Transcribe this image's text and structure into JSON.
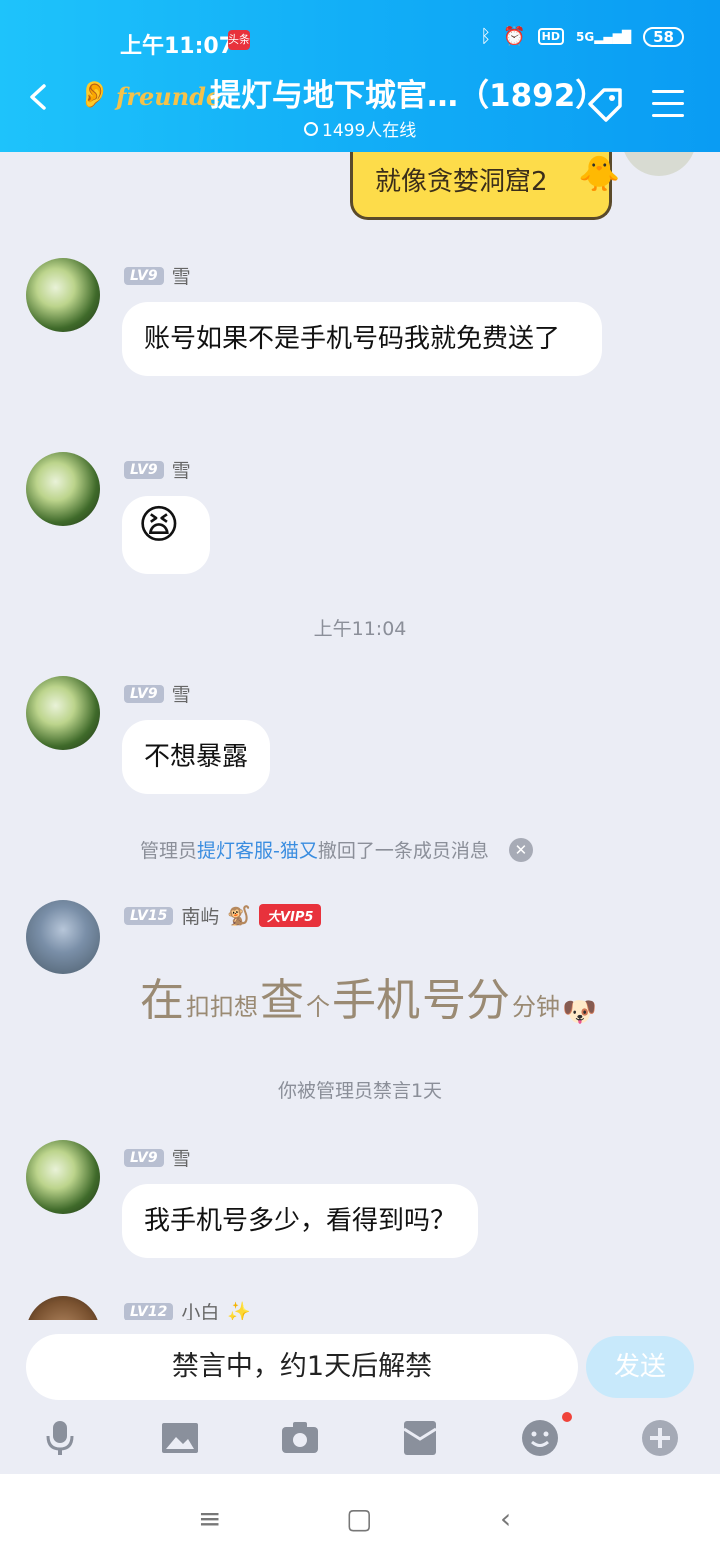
{
  "status": {
    "time": "上午11:07",
    "news_badge": "头条",
    "network": "5G",
    "hd": "HD",
    "battery": "58"
  },
  "header": {
    "brand": "freunde",
    "title": "提灯与地下城官…（1892）",
    "online": "1499人在线"
  },
  "messages": [
    {
      "type": "sticker",
      "text": "就像贪婪洞窟2"
    },
    {
      "type": "msg",
      "level": "LV9",
      "name": "雪",
      "text": "账号如果不是手机号码我就免费送了"
    },
    {
      "type": "msg",
      "level": "LV9",
      "name": "雪",
      "text": "😫"
    },
    {
      "type": "time",
      "text": "上午11:04"
    },
    {
      "type": "msg",
      "level": "LV9",
      "name": "雪",
      "text": "不想暴露"
    },
    {
      "type": "system",
      "prefix": "管理员",
      "admin": "提灯客服-猫又",
      "suffix": "撤回了一条成员消息"
    },
    {
      "type": "msg",
      "level": "LV15",
      "name": "南屿",
      "vip": "大VIP5",
      "big_text": [
        "在",
        "扣扣想",
        "查",
        "个",
        "手机",
        "号分",
        "分钟"
      ]
    },
    {
      "type": "notice",
      "text": "你被管理员禁言1天"
    },
    {
      "type": "msg",
      "level": "LV9",
      "name": "雪",
      "text": "我手机号多少，看得到吗？"
    },
    {
      "type": "msg",
      "level": "LV12",
      "name": "小白"
    }
  ],
  "input": {
    "placeholder": "禁言中，约1天后解禁",
    "send": "发送"
  },
  "toolbar": {
    "icons": [
      "mic-icon",
      "image-icon",
      "camera-icon",
      "red-packet-icon",
      "emoji-icon",
      "plus-icon"
    ]
  }
}
